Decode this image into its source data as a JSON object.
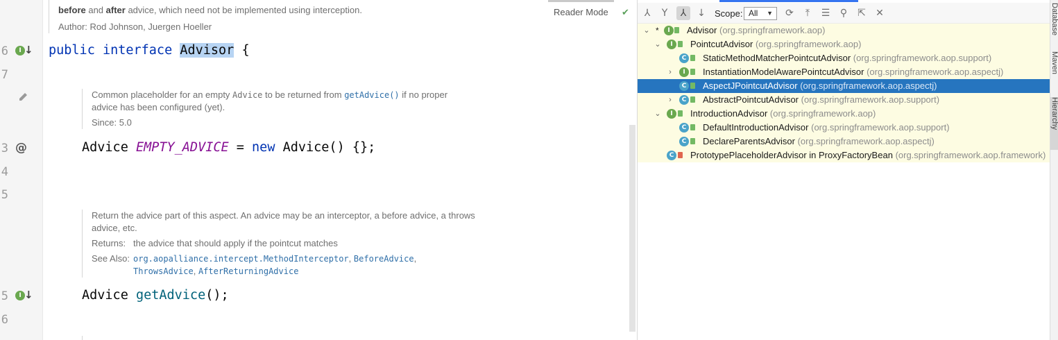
{
  "editor": {
    "doc_top": {
      "line1_before": "before",
      "line1_and": " and ",
      "line1_after": "after",
      "line1_rest": " advice, which need not be implemented using interception.",
      "author_line": "Author: Rod Johnson, Juergen Hoeller"
    },
    "reader_mode": "Reader Mode",
    "line_numbers": [
      "6",
      "7",
      "3",
      "4",
      "5",
      "5",
      "6"
    ],
    "code_line1": {
      "kw1": "public",
      "kw2": "interface",
      "name": "Advisor",
      "brace": " {"
    },
    "doc1": {
      "line1_pre": "Common placeholder for an empty ",
      "line1_code": "Advice",
      "line1_mid": " to be returned from ",
      "line1_link": "getAdvice()",
      "line1_post": " if no proper",
      "line2": "advice has been configured (yet).",
      "since": "Since: 5.0"
    },
    "code_line2": {
      "type": "Advice",
      "const": "EMPTY_ADVICE",
      "eq": " = ",
      "kw": "new",
      "rest": " Advice() {};"
    },
    "doc2": {
      "line1": "Return the advice part of this aspect. An advice may be an interceptor, a before advice, a throws",
      "line2": "advice, etc.",
      "returns_label": "Returns:",
      "returns_text": "the advice that should apply if the pointcut matches",
      "seealso_label": "See Also:",
      "link1": "org.aopalliance.intercept.MethodInterceptor",
      "link2": "BeforeAdvice",
      "link3": "ThrowsAdvice",
      "link4": "AfterReturningAdvice",
      "sep": ", "
    },
    "code_line3": {
      "type": "Advice",
      "method": "getAdvice",
      "rest": "();"
    }
  },
  "hierarchy": {
    "scope_label": "Scope:",
    "scope_value": "All",
    "toolbar_icons": [
      "subtypes-hierarchy-icon",
      "supertypes-hierarchy-icon",
      "class-hierarchy-icon",
      "sort-alphabetically-icon",
      "refresh-icon",
      "export-icon",
      "expand-all-icon",
      "pin-icon",
      "open-in-editor-icon",
      "close-icon"
    ],
    "rows": [
      {
        "name": "Advisor",
        "pkg": "(org.springframework.aop)",
        "icon": "I",
        "chevron": "v",
        "star": "*"
      },
      {
        "name": "PointcutAdvisor",
        "pkg": "(org.springframework.aop)",
        "icon": "I",
        "chevron": "v"
      },
      {
        "name": "StaticMethodMatcherPointcutAdvisor",
        "pkg": "(org.springframework.aop.support)",
        "icon": "C"
      },
      {
        "name": "InstantiationModelAwarePointcutAdvisor",
        "pkg": "(org.springframework.aop.aspectj)",
        "icon": "I",
        "chevron": ">"
      },
      {
        "name": "AspectJPointcutAdvisor",
        "pkg": "(org.springframework.aop.aspectj)",
        "icon": "C",
        "selected": true
      },
      {
        "name": "AbstractPointcutAdvisor",
        "pkg": "(org.springframework.aop.support)",
        "icon": "C",
        "chevron": ">"
      },
      {
        "name": "IntroductionAdvisor",
        "pkg": "(org.springframework.aop)",
        "icon": "I",
        "chevron": "v"
      },
      {
        "name": "DefaultIntroductionAdvisor",
        "pkg": "(org.springframework.aop.support)",
        "icon": "C"
      },
      {
        "name": "DeclareParentsAdvisor",
        "pkg": "(org.springframework.aop.aspectj)",
        "icon": "C"
      },
      {
        "name": "PrototypePlaceholderAdvisor in ProxyFactoryBean",
        "pkg": "(org.springframework.aop.framework)",
        "icon": "C"
      }
    ]
  },
  "side_tabs": [
    "Database",
    "Maven",
    "Hierarchy"
  ]
}
